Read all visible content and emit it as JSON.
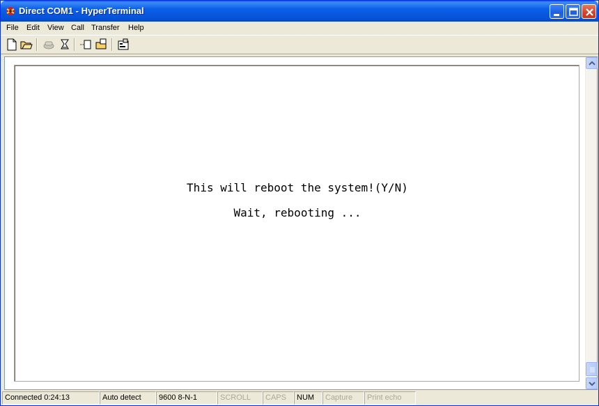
{
  "window": {
    "title": "Direct COM1 - HyperTerminal"
  },
  "menubar": {
    "items": [
      "File",
      "Edit",
      "View",
      "Call",
      "Transfer",
      "Help"
    ]
  },
  "toolbar": {
    "icons": [
      "new-connection-icon",
      "open-icon",
      "disconnect-icon",
      "dial-icon",
      "send-icon",
      "receive-icon",
      "properties-icon"
    ]
  },
  "terminal": {
    "lines": [
      "This will reboot the system!(Y/N)",
      "Wait, rebooting ..."
    ]
  },
  "statusbar": {
    "connected": "Connected 0:24:13",
    "detect": "Auto detect",
    "settings": "9600 8-N-1",
    "scroll": "SCROLL",
    "caps": "CAPS",
    "num": "NUM",
    "capture": "Capture",
    "print_echo": "Print echo"
  },
  "colors": {
    "title_bar": "#0b5fe8",
    "close_button": "#d5432a",
    "face": "#ece9d8"
  }
}
